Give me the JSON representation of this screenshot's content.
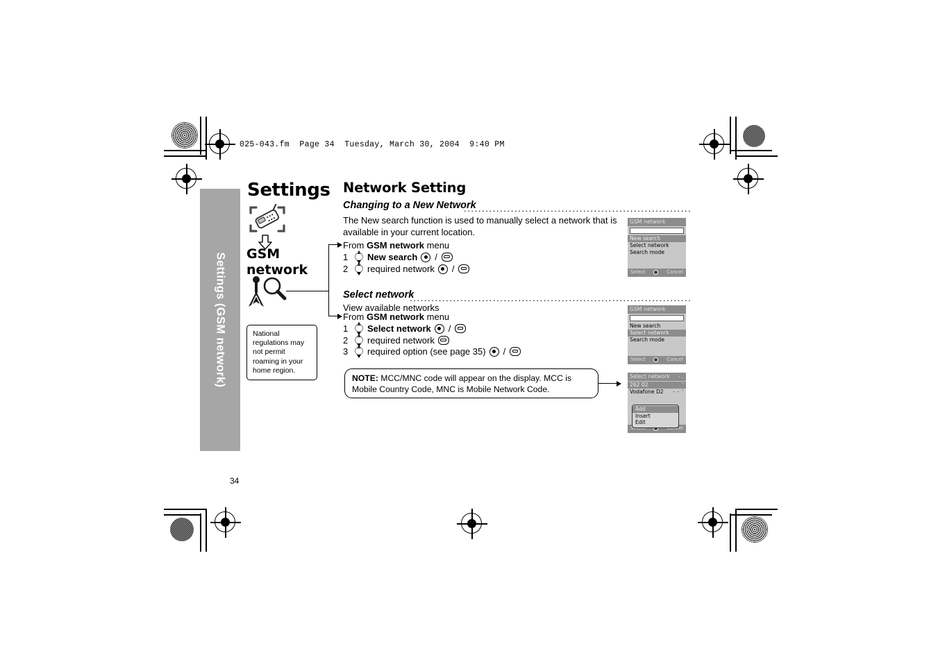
{
  "print_header": "025-043.fm  Page 34  Tuesday, March 30, 2004  9:40 PM",
  "page_number": "34",
  "sidebar": {
    "label": "Settings (GSM network)",
    "bg_color": "#a6a6a6",
    "text_color": "#ffffff"
  },
  "chapter": {
    "title": "Settings",
    "phone_icon": "phone-in-brackets-icon",
    "arrow_icon": "arrow-down-hollow-icon",
    "menu_path_line1": "GSM",
    "menu_path_line2": "network",
    "antenna_icon": "antenna-magnifier-icon",
    "callout": "National regulations may not permit roaming in your home region."
  },
  "main": {
    "title": "Network Setting",
    "sections": [
      {
        "heading": "Changing to a New Network",
        "body": "The New search function is used to manually select a network that is available in your current location.",
        "from_prefix": "From ",
        "from_bold": "GSM network",
        "from_suffix": " menu",
        "steps": [
          {
            "num": "1",
            "label": "New search",
            "bold": true,
            "keys": [
              "select",
              "soft"
            ]
          },
          {
            "num": "2",
            "label": "required network",
            "bold": false,
            "keys": [
              "select",
              "soft"
            ]
          }
        ]
      },
      {
        "heading": "Select network",
        "body": "View available networks",
        "from_prefix": "From ",
        "from_bold": "GSM network",
        "from_suffix": " menu",
        "steps": [
          {
            "num": "1",
            "label": "Select network",
            "bold": true,
            "keys": [
              "select",
              "soft"
            ]
          },
          {
            "num": "2",
            "label": "required network",
            "bold": false,
            "keys": [
              "soft"
            ]
          },
          {
            "num": "3",
            "label": "required option (see page 35)",
            "bold": false,
            "keys": [
              "select",
              "soft"
            ]
          }
        ]
      }
    ],
    "note": {
      "label": "NOTE:",
      "text": " MCC/MNC code will appear on the display. MCC is Mobile Country Code, MNC is Mobile Network Code."
    }
  },
  "screens": [
    {
      "name": "gsm-network-new-search",
      "title": "GSM network",
      "has_input": true,
      "items": [
        {
          "label": "New search",
          "highlighted": true
        },
        {
          "label": "Select network",
          "highlighted": false
        },
        {
          "label": "Search mode",
          "highlighted": false
        }
      ],
      "footer_left": "Select",
      "footer_right": "Cancel"
    },
    {
      "name": "gsm-network-select-network",
      "title": "GSM network",
      "has_input": true,
      "items": [
        {
          "label": "New search",
          "highlighted": false
        },
        {
          "label": "Select network",
          "highlighted": true
        },
        {
          "label": "Search mode",
          "highlighted": false
        }
      ],
      "footer_left": "Select",
      "footer_right": "Cancel"
    },
    {
      "name": "select-network-list",
      "title": "Select network",
      "title_signal": "- .",
      "rows": [
        {
          "label": "262 02",
          "highlighted": true,
          "signal": "'"
        },
        {
          "label": "Vodafone D2",
          "highlighted": false,
          "signal": "- - '"
        }
      ],
      "popup": [
        {
          "label": "Add",
          "highlighted": true
        },
        {
          "label": "Insert",
          "highlighted": false
        },
        {
          "label": "Edit",
          "highlighted": false
        }
      ],
      "footer_left": "Select",
      "footer_right": "Cancel"
    }
  ]
}
